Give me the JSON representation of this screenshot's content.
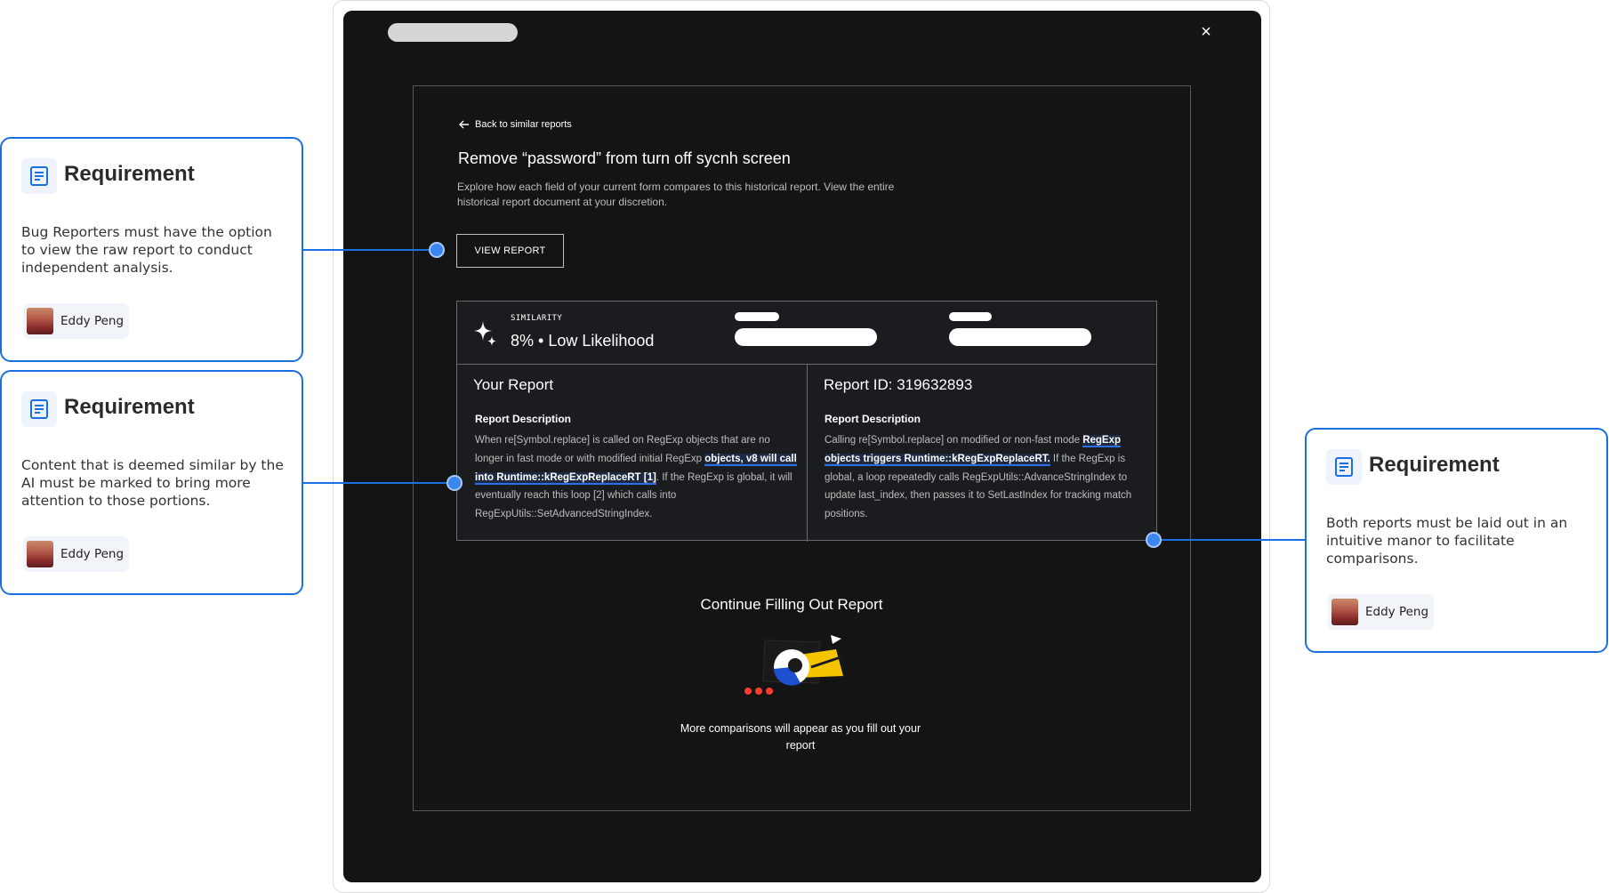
{
  "modal": {
    "close_icon": "×",
    "back_link": "Back to similar reports",
    "title": "Remove “password” from turn off sycnh screen",
    "description": "Explore how each field of your current form compares to this historical report. View the entire historical report document at your discretion.",
    "view_button": "VIEW REPORT",
    "similarity": {
      "label": "SIMILARITY",
      "value": "8% • Low Likelihood"
    },
    "your_report": {
      "heading": "Your Report",
      "subheading": "Report Description",
      "text_before": "When re[Symbol.replace] is called on RegExp objects that are no longer in fast mode or with modified initial RegExp ",
      "highlight": "objects, v8 will call into Runtime::kRegExpReplaceRT [1]",
      "text_after": ". If the RegExp is global, it will eventually reach this loop [2] which calls into RegExpUtils::SetAdvancedStringIndex."
    },
    "historical_report": {
      "heading": "Report ID: 319632893",
      "subheading": "Report Description",
      "text_before": "Calling re[Symbol.replace] on modified or non-fast mode ",
      "highlight": "RegExp objects triggers Runtime::kRegExpReplaceRT.",
      "text_after": " If the RegExp is global, a loop repeatedly calls RegExpUtils::AdvanceStringIndex to update last_index, then passes it to SetLastIndex for tracking match positions."
    },
    "continue_title": "Continue Filling Out Report",
    "continue_sub": "More comparisons will appear as you fill out your report"
  },
  "requirements": [
    {
      "title": "Requirement",
      "text": "Bug Reporters must have the option to view the raw report to conduct independent analysis.",
      "author": "Eddy Peng"
    },
    {
      "title": "Requirement",
      "text": "Content that is deemed similar by the AI must be marked to bring more attention to those portions.",
      "author": "Eddy Peng"
    },
    {
      "title": "Requirement",
      "text": "Both reports must be laid out in an intuitive manor to facilitate comparisons.",
      "author": "Eddy Peng"
    }
  ],
  "colors": {
    "accent": "#1c6fe0",
    "modal_bg": "#141414",
    "highlight_underline": "#2f6fe4"
  },
  "icons": {
    "note": "note-icon",
    "back": "arrow-left-icon",
    "close": "close-icon",
    "sparkle": "sparkle-icon"
  }
}
